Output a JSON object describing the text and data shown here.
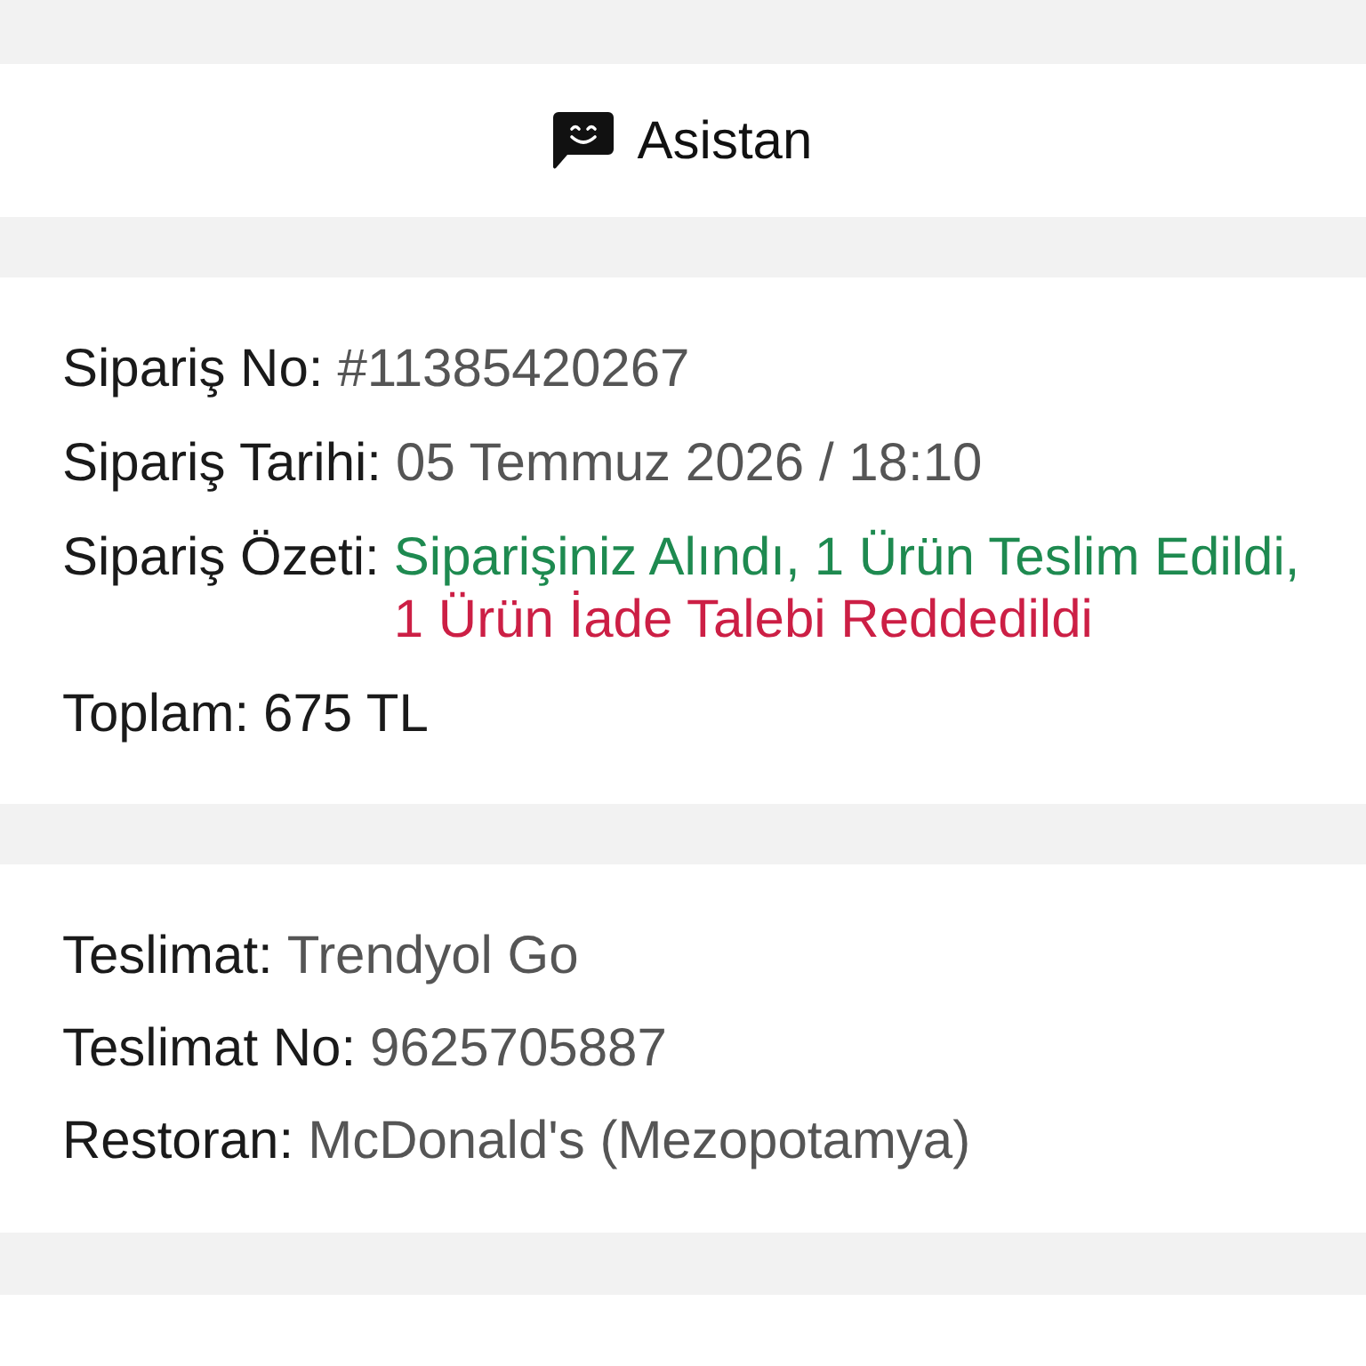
{
  "header": {
    "title": "Asistan"
  },
  "order": {
    "rows": [
      {
        "kind": "plain",
        "label": "Sipariş No:",
        "value": "#11385420267"
      },
      {
        "kind": "plain",
        "label": "Sipariş Tarihi:",
        "value": "05 Temmuz 2026 / 18:10"
      },
      {
        "kind": "statuses",
        "label": "Sipariş Özeti:",
        "statuses": [
          {
            "text": "Siparişiniz Alındı,",
            "color": "#1e8a50"
          },
          {
            "text": "1 Ürün Teslim Edildi,",
            "color": "#1e8a50"
          },
          {
            "text": "1 Ürün İade Talebi Reddedildi",
            "color": "#cc1f45"
          }
        ]
      },
      {
        "kind": "strong",
        "label": "Toplam:",
        "value": "675 TL"
      }
    ]
  },
  "delivery": {
    "rows": [
      {
        "kind": "plain",
        "label": "Teslimat:",
        "value": "Trendyol Go"
      },
      {
        "kind": "plain",
        "label": "Teslimat No:",
        "value": "9625705887"
      },
      {
        "kind": "plain",
        "label": "Restoran:",
        "value": "McDonald's (Mezopotamya)"
      }
    ]
  }
}
